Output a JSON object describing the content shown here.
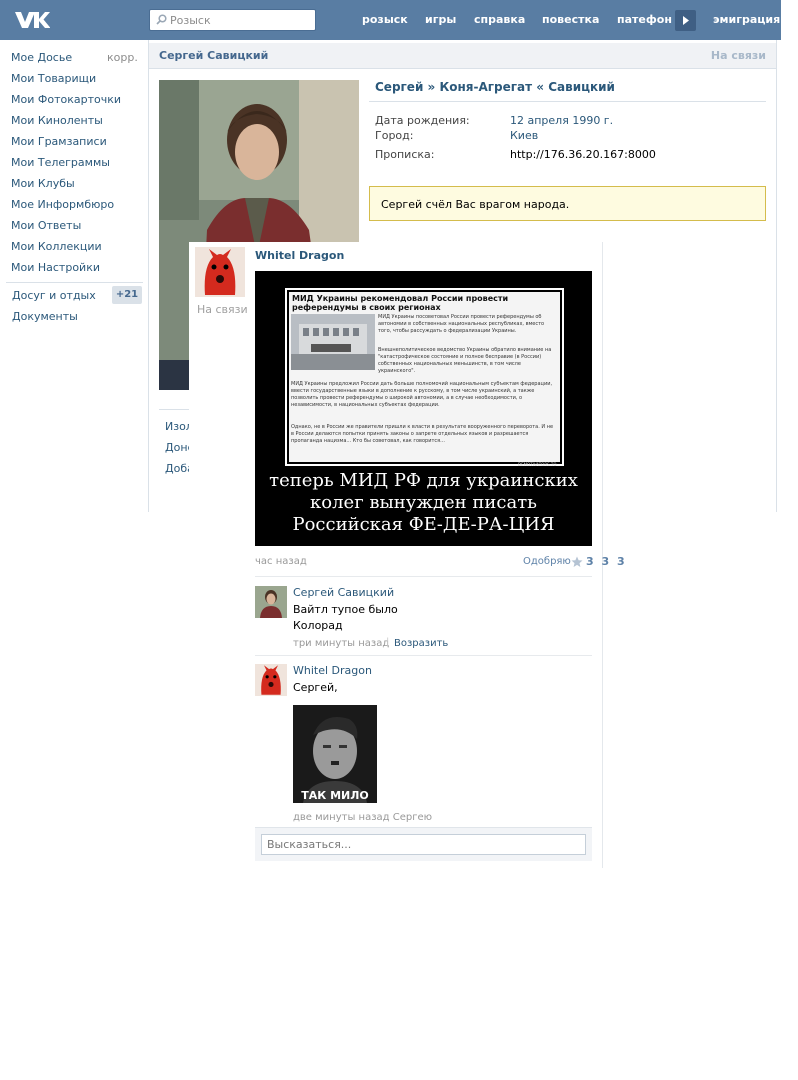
{
  "header": {
    "search_placeholder": "Розыск",
    "nav": [
      "розыск",
      "игры",
      "справка",
      "повестка",
      "патефон",
      "эмиграция"
    ]
  },
  "left_menu": {
    "items": [
      "Мое Досье",
      "Мои Товарищи",
      "Мои Фотокарточки",
      "Мои Киноленты",
      "Мои Грамзаписи",
      "Мои Телеграммы",
      "Мои Клубы",
      "Мое Информбюро",
      "Мои Ответы",
      "Мои Коллекции",
      "Мои Настройки"
    ],
    "korr": "корр.",
    "extra": [
      "Досуг и отдых",
      "Документы"
    ],
    "badge": "+21"
  },
  "profile": {
    "name_bar": "Сергей Савицкий",
    "online": "На связи",
    "full_name": "Сергей » Коня-Агрегат « Савицкий",
    "fields": [
      {
        "label": "Дата рождения:",
        "value": "12 апреля 1990 г."
      },
      {
        "label": "Город:",
        "value": "Киев"
      },
      {
        "label": "Прописка:",
        "value": "http://176.36.20.167:8000"
      }
    ],
    "notice": "Сергей счёл Вас врагом народа.",
    "side_links": [
      "Изол",
      "Доне",
      "Доба"
    ]
  },
  "post": {
    "author": "Whitel Dragon",
    "online": "На связи",
    "demotivator": {
      "headline": "МИД Украины рекомендовал России провести референдумы в своих регионах",
      "para1": "МИД Украины посоветовал России провести референдумы об автономии в собственных национальных республиках, вместо того, чтобы рассуждать о федерализации Украины.",
      "para2": "Внешнеполитическое ведомство Украины обратило внимание на \"катастрофическое состояние и полное бесправие (в России) собственных национальных меньшинств, в том числе украинского\".",
      "para3": "МИД Украины предложил России дать больше полномочий национальным субъектам федерации, ввести государственные языки в дополнение к русскому, в том числе украинский, а также позволить провести референдумы о широкой автономии, а в случае необходимости, о независимости, в национальных субъектах федерации.",
      "para4": "Однако, не в России же правители пришли к власти в результате вооруженного переворота. И не в России делаются попытки принять законы о запрете отдельных языков и разрешается пропаганда нацизма... Кто бы советовал, как говорится...",
      "watermark": "DEMOTIVATORS.TO",
      "caption": "теперь МИД РФ для украинских колег вынужден писать Российская ФЕ-ДЕ-РА-ЦИЯ"
    },
    "time": "час назад",
    "like_label": "Одобряю",
    "like_count": "3 3 3",
    "comments": [
      {
        "author": "Сергей Савицкий",
        "lines": [
          "Вайтл тупое было",
          "Колорад"
        ],
        "time": "три минуты назад",
        "reply": "Возразить"
      },
      {
        "author": "Whitel Dragon",
        "lines": [
          "Сергей,"
        ],
        "image_caption": "ТАК МИЛО",
        "time": "две минуты назад Сергею"
      }
    ],
    "reply_placeholder": "Высказаться..."
  }
}
